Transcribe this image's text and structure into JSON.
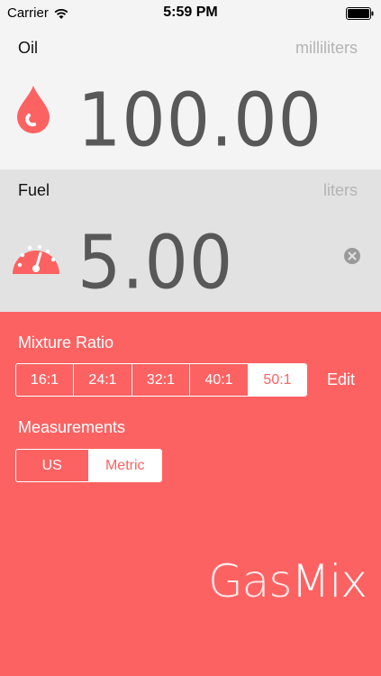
{
  "status_bar": {
    "carrier": "Carrier",
    "time": "5:59 PM"
  },
  "oil": {
    "name": "Oil",
    "unit": "milliliters",
    "value": "100.00",
    "icon": "drop-icon"
  },
  "fuel": {
    "name": "Fuel",
    "unit": "liters",
    "value": "5.00",
    "icon": "gauge-icon"
  },
  "mixture": {
    "label": "Mixture Ratio",
    "options": [
      "16:1",
      "24:1",
      "32:1",
      "40:1",
      "50:1"
    ],
    "selected": "50:1",
    "edit_label": "Edit"
  },
  "measurements": {
    "label": "Measurements",
    "options": [
      "US",
      "Metric"
    ],
    "selected": "Metric"
  },
  "app": {
    "logo_part1": "Gas",
    "logo_part2": "Mix"
  },
  "colors": {
    "accent": "#fd6263",
    "oil_panel": "#f4f4f4",
    "fuel_panel": "#e2e2e2",
    "value_text": "#585858"
  }
}
